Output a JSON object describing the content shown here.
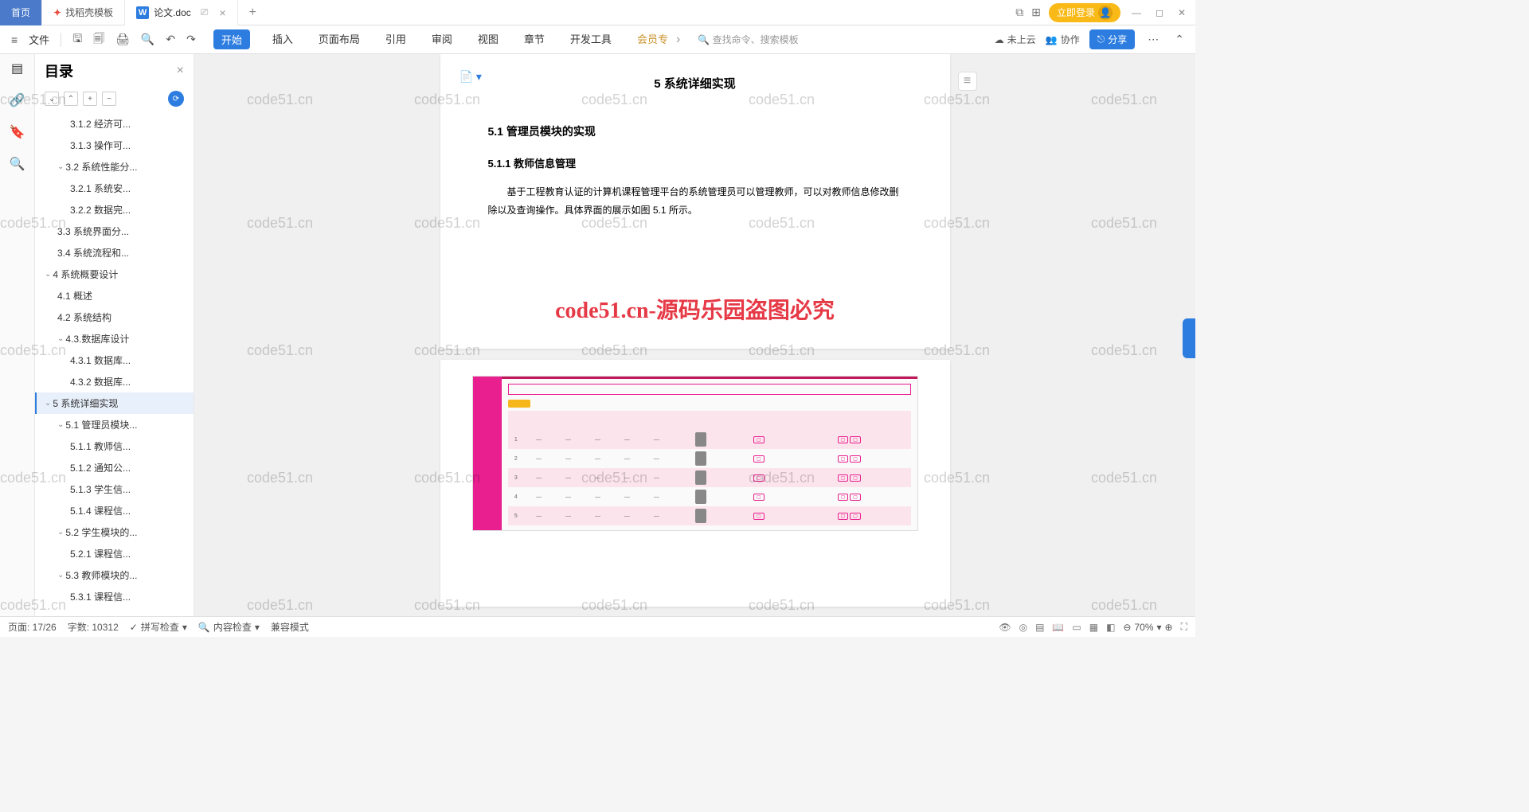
{
  "titlebar": {
    "home": "首页",
    "template": "找稻壳模板",
    "doc": "论文.doc",
    "login": "立即登录"
  },
  "ribbon": {
    "file": "文件",
    "tabs": [
      "开始",
      "插入",
      "页面布局",
      "引用",
      "审阅",
      "视图",
      "章节",
      "开发工具",
      "会员专"
    ],
    "search": "查找命令、搜索模板",
    "cloud": "未上云",
    "collab": "协作",
    "share": "分享"
  },
  "toc": {
    "title": "目录",
    "items": [
      {
        "indent": 3,
        "caret": false,
        "label": "3.1.2 经济可..."
      },
      {
        "indent": 3,
        "caret": false,
        "label": "3.1.3 操作可..."
      },
      {
        "indent": 2,
        "caret": true,
        "label": "3.2 系统性能分..."
      },
      {
        "indent": 3,
        "caret": false,
        "label": "3.2.1 系统安..."
      },
      {
        "indent": 3,
        "caret": false,
        "label": "3.2.2 数据完..."
      },
      {
        "indent": 2,
        "caret": false,
        "label": "3.3 系统界面分..."
      },
      {
        "indent": 2,
        "caret": false,
        "label": "3.4 系统流程和..."
      },
      {
        "indent": 1,
        "caret": true,
        "label": "4 系统概要设计"
      },
      {
        "indent": 2,
        "caret": false,
        "label": "4.1 概述"
      },
      {
        "indent": 2,
        "caret": false,
        "label": "4.2 系统结构"
      },
      {
        "indent": 2,
        "caret": true,
        "label": "4.3.数据库设计"
      },
      {
        "indent": 3,
        "caret": false,
        "label": "4.3.1 数据库..."
      },
      {
        "indent": 3,
        "caret": false,
        "label": "4.3.2 数据库..."
      },
      {
        "indent": 1,
        "caret": true,
        "label": "5 系统详细实现",
        "selected": true
      },
      {
        "indent": 2,
        "caret": true,
        "label": "5.1 管理员模块..."
      },
      {
        "indent": 3,
        "caret": false,
        "label": "5.1.1 教师信..."
      },
      {
        "indent": 3,
        "caret": false,
        "label": "5.1.2 通知公..."
      },
      {
        "indent": 3,
        "caret": false,
        "label": "5.1.3 学生信..."
      },
      {
        "indent": 3,
        "caret": false,
        "label": "5.1.4 课程信..."
      },
      {
        "indent": 2,
        "caret": true,
        "label": "5.2 学生模块的..."
      },
      {
        "indent": 3,
        "caret": false,
        "label": "5.2.1 课程信..."
      },
      {
        "indent": 2,
        "caret": true,
        "label": "5.3 教师模块的..."
      },
      {
        "indent": 3,
        "caret": false,
        "label": "5.3.1 课程信..."
      }
    ]
  },
  "doc": {
    "h1": "5 系统详细实现",
    "h2": "5.1 管理员模块的实现",
    "h3": "5.1.1 教师信息管理",
    "para": "基于工程教育认证的计算机课程管理平台的系统管理员可以管理教师，可以对教师信息修改删除以及查询操作。具体界面的展示如图 5.1 所示。"
  },
  "watermark_big": "code51.cn-源码乐园盗图必究",
  "watermark": "code51.cn",
  "status": {
    "page": "页面: 17/26",
    "words": "字数: 10312",
    "spell": "拼写检查",
    "content": "内容检查",
    "compat": "兼容模式",
    "zoom": "70%"
  }
}
